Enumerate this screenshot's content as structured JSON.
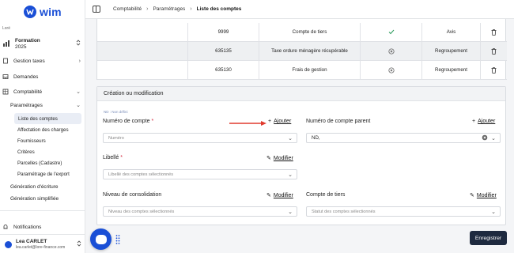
{
  "brand": {
    "name": "wim",
    "color": "#1a4fd6"
  },
  "sidebar": {
    "org_label": "Loré",
    "org_name": "Formation",
    "org_year": "2025",
    "items": [
      {
        "label": "Gestion taxes",
        "icon": "receipt-icon"
      },
      {
        "label": "Demandes",
        "icon": "inbox-icon"
      },
      {
        "label": "Comptabilité",
        "icon": "ledger-icon"
      },
      {
        "label": "Paramétrages"
      },
      {
        "label": "Liste des comptes"
      },
      {
        "label": "Affectation des charges"
      },
      {
        "label": "Fournisseurs"
      },
      {
        "label": "Critères"
      },
      {
        "label": "Parcelles (Cadastre)"
      },
      {
        "label": "Paramétrage de l'export"
      },
      {
        "label": "Génération d'écriture"
      },
      {
        "label": "Génération simplifiée"
      },
      {
        "label": "Notifications",
        "icon": "bell-icon"
      }
    ],
    "user_name": "Lea CARLET",
    "user_email": "lea.carlet@lore-finance.com"
  },
  "breadcrumb": {
    "items": [
      "Comptabilité",
      "Paramétrages"
    ],
    "current": "Liste des comptes"
  },
  "table": {
    "rows": [
      {
        "number": "9999",
        "label": "Compte de tiers",
        "status": "check-icon",
        "type": "Avis"
      },
      {
        "number": "635135",
        "label": "Taxe ordure ménagère récupérable",
        "status": "circle-x-icon",
        "type": "Regroupement"
      },
      {
        "number": "635130",
        "label": "Frais de gestion",
        "status": "circle-x-icon",
        "type": "Regroupement"
      }
    ]
  },
  "form": {
    "title": "Création ou modification",
    "hint": "ND : Non défini",
    "account_number_label": "Numéro de compte",
    "add_label": "Ajouter",
    "account_number_placeholder": "Numéro",
    "parent_label": "Numéro de compte parent",
    "parent_add_label": "Ajouter",
    "parent_value": "ND,",
    "libelle_label": "Libellé",
    "modify_label": "Modifier",
    "libelle_placeholder": "Libellé des comptes sélectionnés",
    "niveau_label": "Niveau de consolidation",
    "niveau_placeholder": "Niveau des comptes sélectionnés",
    "tiers_label": "Compte de tiers",
    "tiers_placeholder": "Statut des comptes sélectionnés"
  },
  "actions": {
    "save_label": "Enregistrer"
  },
  "colors": {
    "accent": "#1a4fd6",
    "save_button": "#1e2a3f",
    "required": "#d4243b",
    "arrow": "#e03a2e"
  }
}
